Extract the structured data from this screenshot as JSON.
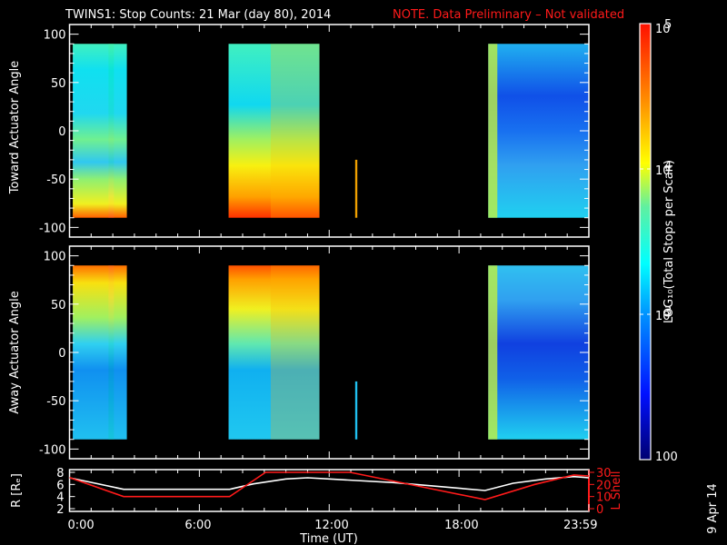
{
  "title": "TWINS1: Stop Counts: 21 Mar (day  80), 2014",
  "note": "NOTE. Data Preliminary – Not validated",
  "side_date": "9 Apr 14",
  "colors": {
    "note": "#ff1a1a",
    "axis": "#ffffff",
    "l_shell": "#ff1a1a",
    "r_line": "#ffffff"
  },
  "chart_data": [
    {
      "type": "heatmap",
      "name": "toward",
      "ylabel": "Toward Actuator Angle",
      "ylim": [
        -110,
        110
      ],
      "yticks": [
        "100",
        "50",
        "0",
        "-50",
        "-100"
      ],
      "ytick_values": [
        100,
        50,
        0,
        -50,
        -100
      ],
      "data_angle_range": [
        -90,
        90
      ],
      "coverage_hours": [
        [
          0.15,
          2.65
        ],
        [
          7.35,
          11.55
        ],
        [
          13.2,
          13.3
        ],
        [
          19.35,
          24.0
        ]
      ]
    },
    {
      "type": "heatmap",
      "name": "away",
      "ylabel": "Away Actuator Angle",
      "ylim": [
        -110,
        110
      ],
      "yticks": [
        "100",
        "50",
        "0",
        "-50",
        "-100"
      ],
      "ytick_values": [
        100,
        50,
        0,
        -50,
        -100
      ],
      "data_angle_range": [
        -90,
        90
      ],
      "coverage_hours": [
        [
          0.15,
          2.65
        ],
        [
          7.35,
          11.55
        ],
        [
          13.2,
          13.3
        ],
        [
          19.35,
          24.0
        ]
      ]
    },
    {
      "type": "line",
      "name": "orbit",
      "xlabel": "Time (UT)",
      "xticks": [
        "0:00",
        "6:00",
        "12:00",
        "18:00",
        "23:59"
      ],
      "xtick_hours": [
        0,
        6,
        12,
        18,
        24
      ],
      "ylabel_left": "R [Rₑ]",
      "ylabel_right": "L Shell",
      "yticks_left": [
        "8",
        "6",
        "4",
        "2"
      ],
      "ytick_left_values": [
        8,
        6,
        4,
        2
      ],
      "yticks_right": [
        "30",
        "20",
        "10",
        "0"
      ],
      "ytick_right_values": [
        30,
        20,
        10,
        0
      ],
      "ylim_left": [
        2,
        8
      ],
      "ylim_right": [
        0,
        30
      ],
      "series": [
        {
          "name": "R",
          "axis": "left",
          "x": [
            0,
            2.5,
            7.4,
            8.5,
            10,
            11,
            12,
            15,
            19.2,
            20.5,
            22,
            23.3,
            24
          ],
          "y": [
            7.1,
            5.2,
            5.2,
            6.1,
            6.9,
            7.1,
            6.9,
            6.3,
            5.0,
            6.2,
            6.9,
            7.3,
            7.1
          ]
        },
        {
          "name": "L Shell",
          "axis": "right",
          "x": [
            0,
            2.5,
            7.4,
            9.06,
            12.97,
            19.2,
            21.5,
            23.3,
            24
          ],
          "y": [
            25.7,
            10,
            10,
            30,
            30,
            7.5,
            20,
            27.8,
            27
          ]
        }
      ]
    }
  ],
  "colorbar": {
    "label": "LOG₁₀(Total Stops per Scan)",
    "ticks": [
      {
        "base": "10",
        "exp": "5"
      },
      {
        "base": "10",
        "exp": "4"
      },
      {
        "base": "10",
        "exp": "3"
      },
      {
        "base": "100",
        "exp": ""
      }
    ],
    "tick_log_values": [
      5,
      4,
      3,
      2
    ],
    "range_log": [
      2,
      5
    ]
  }
}
